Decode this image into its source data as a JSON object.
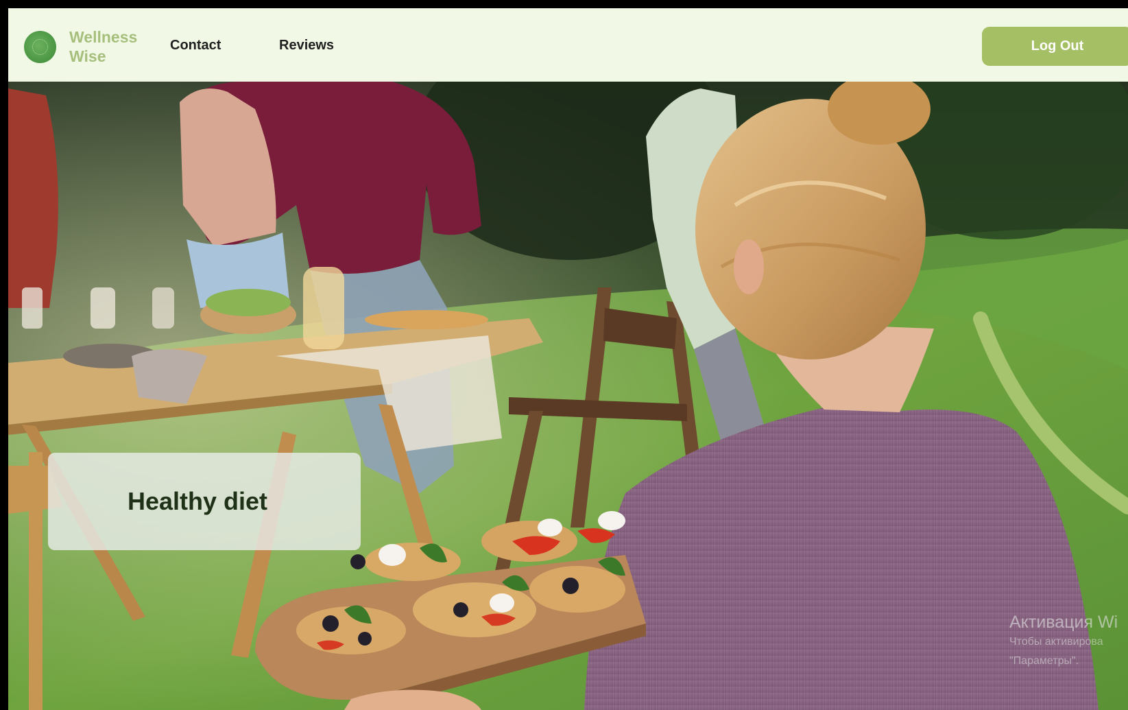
{
  "header": {
    "brand": {
      "line1": "Wellness",
      "line2": "Wise",
      "logo_icon": "leaf-circle-icon"
    },
    "nav": [
      {
        "label": "Contact"
      },
      {
        "label": "Reviews"
      }
    ],
    "logout_label": "Log Out"
  },
  "hero": {
    "title": "Healthy diet",
    "image_subject": "outdoor picnic table with a woman carrying a board of bruschetta"
  },
  "watermark": {
    "line1": "Активация Wi",
    "line2": "Чтобы активирова",
    "line3": "\"Параметры\"."
  },
  "colors": {
    "header_bg": "#f1f9e6",
    "brand_text": "#a6bf7c",
    "accent": "#a4bf64",
    "logo": "#5ba54f",
    "title_text": "#1f3218"
  }
}
